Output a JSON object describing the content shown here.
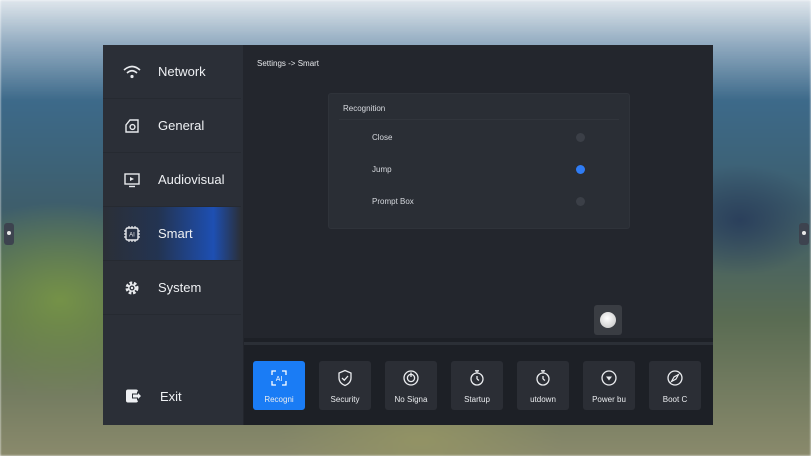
{
  "sidebar": {
    "items": [
      {
        "label": "Network",
        "icon": "wifi-icon"
      },
      {
        "label": "General",
        "icon": "general-icon"
      },
      {
        "label": "Audiovisual",
        "icon": "monitor-icon"
      },
      {
        "label": "Smart",
        "icon": "ai-chip-icon",
        "active": true
      },
      {
        "label": "System",
        "icon": "gear-icon"
      }
    ],
    "exit_label": "Exit"
  },
  "breadcrumb": "Settings -> Smart",
  "recognition": {
    "title": "Recognition",
    "options": [
      {
        "label": "Close",
        "selected": false
      },
      {
        "label": "Jump",
        "selected": true
      },
      {
        "label": "Prompt Box",
        "selected": false
      }
    ]
  },
  "toolbar": {
    "items": [
      {
        "label": "Recogni",
        "icon": "ai-recognition-icon",
        "active": true
      },
      {
        "label": "Security",
        "icon": "shield-icon"
      },
      {
        "label": "No Signa",
        "icon": "power-icon"
      },
      {
        "label": "Startup",
        "icon": "timer-icon"
      },
      {
        "label": "utdown",
        "icon": "timer-icon"
      },
      {
        "label": "Power bu",
        "icon": "power-button-icon"
      },
      {
        "label": "Boot C",
        "icon": "compass-icon"
      }
    ]
  },
  "colors": {
    "accent": "#1a7cf5",
    "panel": "#23262d",
    "sidebar": "#2b2f37"
  }
}
